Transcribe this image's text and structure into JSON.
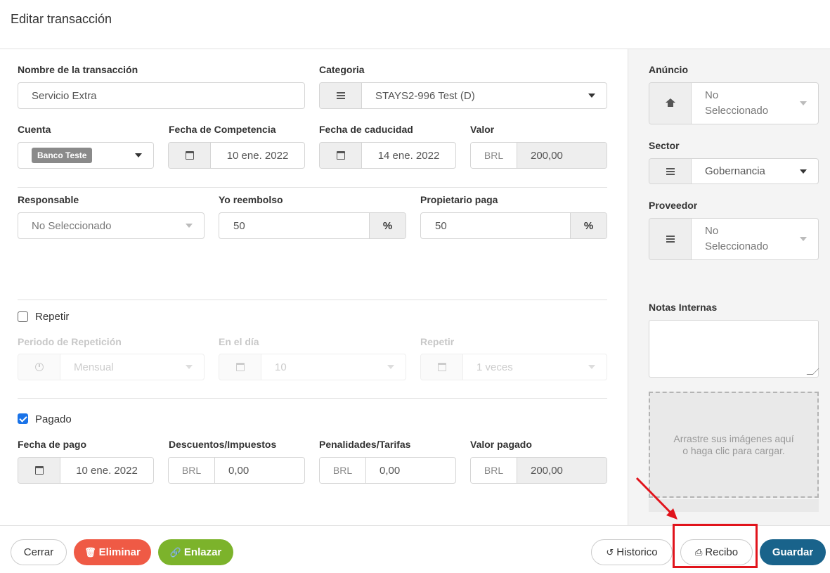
{
  "header": {
    "title": "Editar transacción"
  },
  "form": {
    "name": {
      "label": "Nombre de la transacción",
      "value": "Servicio Extra"
    },
    "category": {
      "label": "Categoria",
      "value": "STAYS2-996 Test (D)"
    },
    "account": {
      "label": "Cuenta",
      "value": "Banco Teste"
    },
    "competence_date": {
      "label": "Fecha de Competencia",
      "value": "10 ene. 2022"
    },
    "due_date": {
      "label": "Fecha de caducidad",
      "value": "14 ene. 2022"
    },
    "amount": {
      "label": "Valor",
      "currency": "BRL",
      "value": "200,00"
    },
    "responsible": {
      "label": "Responsable",
      "value": "No Seleccionado"
    },
    "reimburse": {
      "label": "Yo reembolso",
      "value": "50",
      "suffix": "%"
    },
    "owner_pays": {
      "label": "Propietario paga",
      "value": "50",
      "suffix": "%"
    },
    "repeat": {
      "label": "Repetir",
      "checked": false,
      "period": {
        "label": "Periodo de Repetición",
        "value": "Mensual"
      },
      "day": {
        "label": "En el día",
        "value": "10"
      },
      "times": {
        "label": "Repetir",
        "value": "1 veces"
      }
    },
    "paid": {
      "label": "Pagado",
      "checked": true,
      "payment_date": {
        "label": "Fecha de pago",
        "value": "10 ene. 2022"
      },
      "discounts": {
        "label": "Descuentos/Impuestos",
        "currency": "BRL",
        "value": "0,00"
      },
      "penalties": {
        "label": "Penalidades/Tarifas",
        "currency": "BRL",
        "value": "0,00"
      },
      "paid_amount": {
        "label": "Valor pagado",
        "currency": "BRL",
        "value": "200,00"
      }
    }
  },
  "sidebar": {
    "listing": {
      "label": "Anúncio",
      "value_line1": "No",
      "value_line2": "Seleccionado"
    },
    "sector": {
      "label": "Sector",
      "value": "Gobernancia"
    },
    "provider": {
      "label": "Proveedor",
      "value_line1": "No",
      "value_line2": "Seleccionado"
    },
    "notes": {
      "label": "Notas Internas",
      "value": ""
    },
    "dropzone": {
      "text": "Arrastre sus imágenes aquí o haga clic para cargar."
    }
  },
  "footer": {
    "close": "Cerrar",
    "delete": "Eliminar",
    "link": "Enlazar",
    "history": "Historico",
    "receipt": "Recibo",
    "save": "Guardar"
  },
  "colors": {
    "delete": "#ef5a45",
    "link": "#7cb32b",
    "save": "#19638b",
    "checkbox": "#1a73e8",
    "highlight": "#e1141c"
  }
}
